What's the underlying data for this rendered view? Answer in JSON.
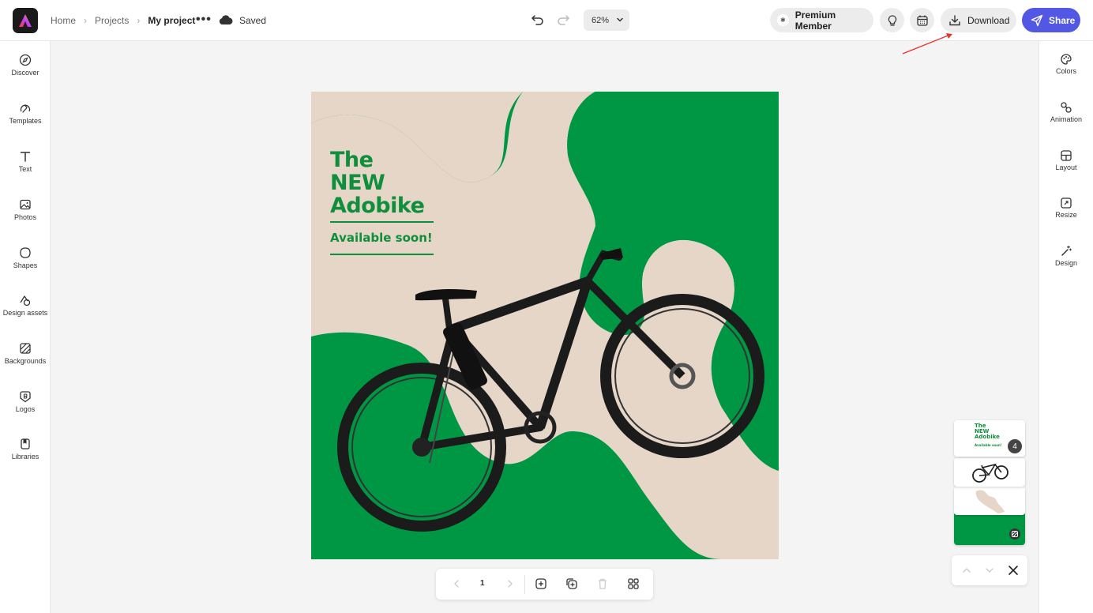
{
  "topbar": {
    "breadcrumb": [
      "Home",
      "Projects",
      "My project"
    ],
    "save_status": "Saved",
    "zoom": "62%",
    "premium_label": "Premium Member",
    "download_label": "Download",
    "share_label": "Share"
  },
  "left_rail": {
    "items": [
      {
        "label": "Discover",
        "icon": "compass-icon"
      },
      {
        "label": "Templates",
        "icon": "templates-icon"
      },
      {
        "label": "Text",
        "icon": "text-icon"
      },
      {
        "label": "Photos",
        "icon": "photo-icon"
      },
      {
        "label": "Shapes",
        "icon": "shapes-icon"
      },
      {
        "label": "Design assets",
        "icon": "design-assets-icon"
      },
      {
        "label": "Backgrounds",
        "icon": "backgrounds-icon"
      },
      {
        "label": "Logos",
        "icon": "logo-icon"
      },
      {
        "label": "Libraries",
        "icon": "libraries-icon"
      }
    ]
  },
  "right_rail": {
    "items": [
      {
        "label": "Colors",
        "icon": "palette-icon"
      },
      {
        "label": "Animation",
        "icon": "animation-icon"
      },
      {
        "label": "Layout",
        "icon": "layout-icon"
      },
      {
        "label": "Resize",
        "icon": "resize-icon"
      },
      {
        "label": "Design",
        "icon": "magic-wand-icon"
      }
    ]
  },
  "canvas": {
    "headline": [
      "The",
      "NEW",
      "Adobike"
    ],
    "subhead": "Available soon!",
    "colors": {
      "green": "#009744",
      "beige": "#e6d6c8",
      "text_green": "#0f8f3c"
    }
  },
  "pagination": {
    "page": "1"
  },
  "layers_panel": {
    "count": "4",
    "thumb_headline": [
      "The",
      "NEW",
      "Adobike"
    ],
    "thumb_subhead": "Available soon!"
  },
  "colors": {
    "share": "#5258e4",
    "annotation_arrow": "#e8372a"
  }
}
